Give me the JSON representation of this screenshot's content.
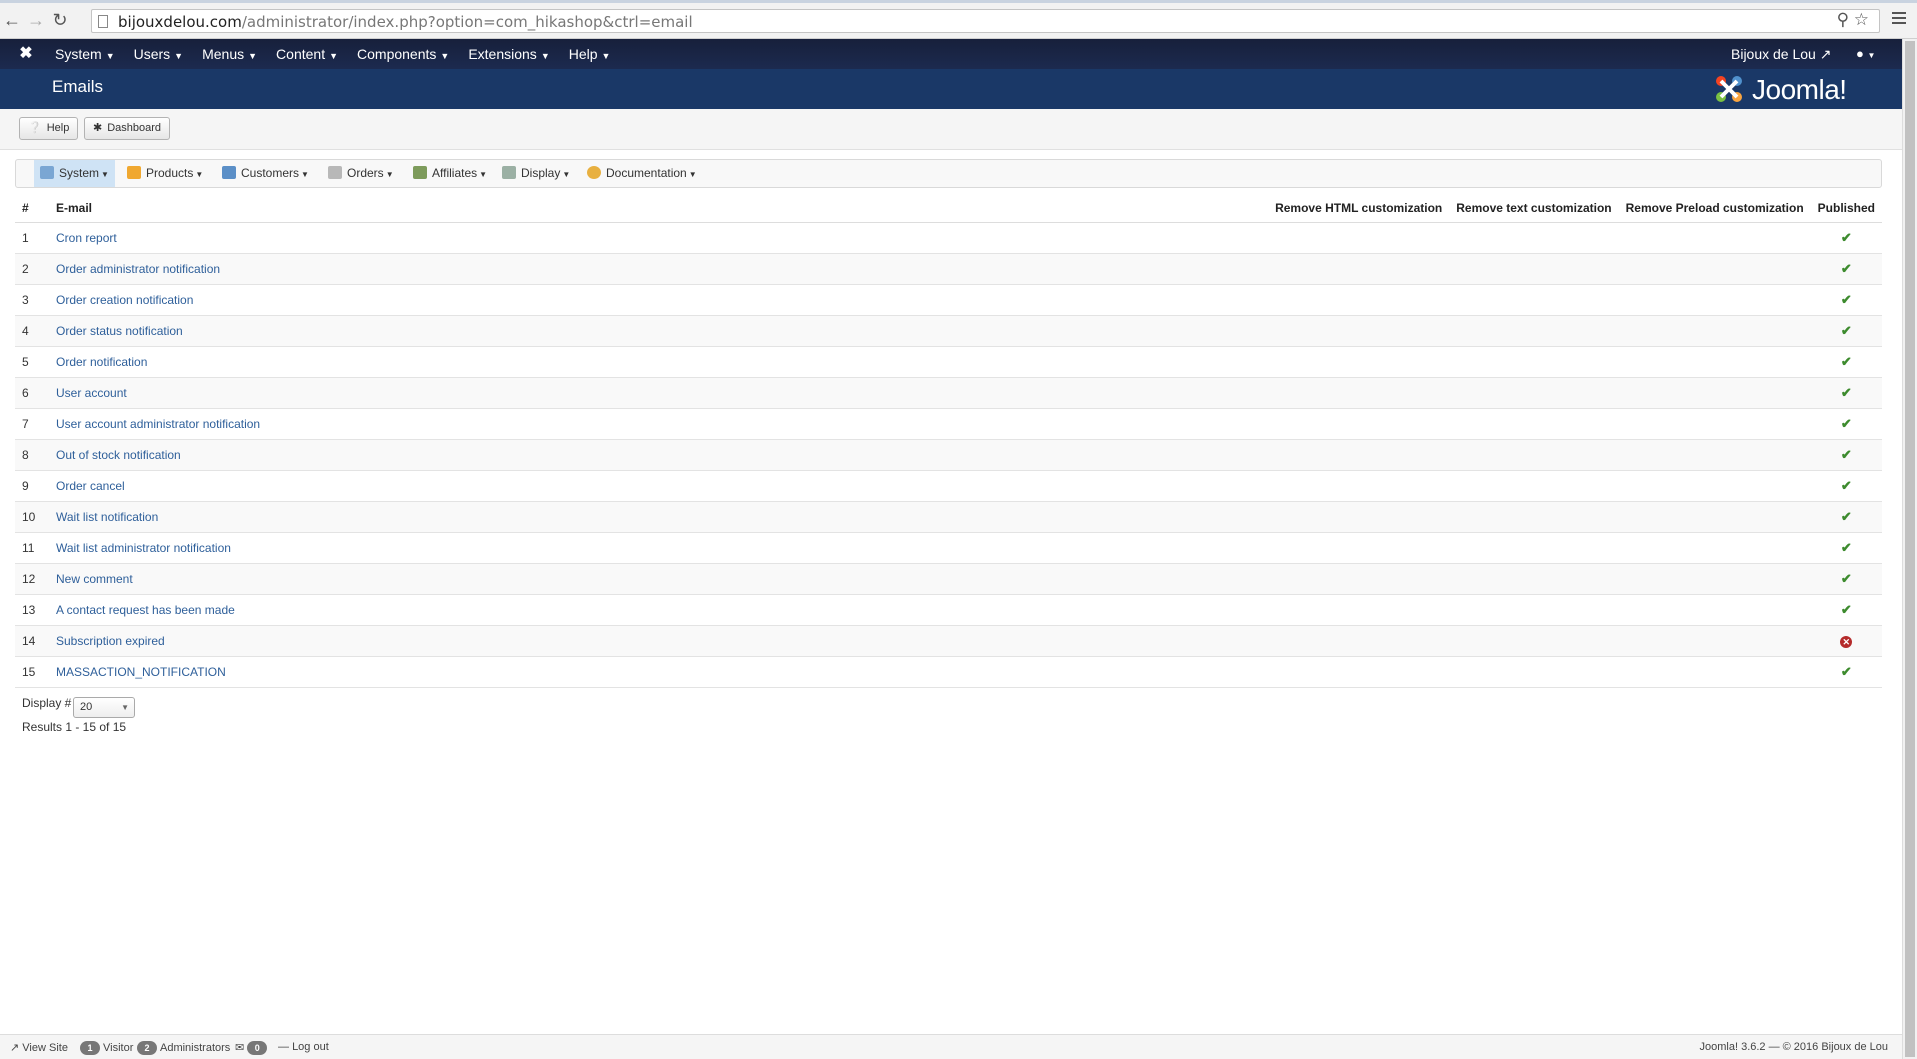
{
  "browser": {
    "url_domain": "bijouxdelou.com",
    "url_path": "/administrator/index.php?option=com_hikashop&ctrl=email"
  },
  "topnav": {
    "items": [
      "System",
      "Users",
      "Menus",
      "Content",
      "Components",
      "Extensions",
      "Help"
    ],
    "site_name": "Bijoux de Lou"
  },
  "header": {
    "title": "Emails",
    "logo_text": "Joomla!"
  },
  "toolbar": {
    "help_label": "Help",
    "dashboard_label": "Dashboard"
  },
  "hika_menu": {
    "items": [
      "System",
      "Products",
      "Customers",
      "Orders",
      "Affiliates",
      "Display",
      "Documentation"
    ]
  },
  "table": {
    "columns": [
      "#",
      "E-mail",
      "Remove HTML customization",
      "Remove text customization",
      "Remove Preload customization",
      "Published"
    ],
    "rows": [
      {
        "num": "1",
        "name": "Cron report",
        "published": true
      },
      {
        "num": "2",
        "name": "Order administrator notification",
        "published": true
      },
      {
        "num": "3",
        "name": "Order creation notification",
        "published": true
      },
      {
        "num": "4",
        "name": "Order status notification",
        "published": true
      },
      {
        "num": "5",
        "name": "Order notification",
        "published": true
      },
      {
        "num": "6",
        "name": "User account",
        "published": true
      },
      {
        "num": "7",
        "name": "User account administrator notification",
        "published": true
      },
      {
        "num": "8",
        "name": "Out of stock notification",
        "published": true
      },
      {
        "num": "9",
        "name": "Order cancel",
        "published": true
      },
      {
        "num": "10",
        "name": "Wait list notification",
        "published": true
      },
      {
        "num": "11",
        "name": "Wait list administrator notification",
        "published": true
      },
      {
        "num": "12",
        "name": "New comment",
        "published": true
      },
      {
        "num": "13",
        "name": "A contact request has been made",
        "published": true
      },
      {
        "num": "14",
        "name": "Subscription expired",
        "published": false
      },
      {
        "num": "15",
        "name": "MASSACTION_NOTIFICATION",
        "published": true
      }
    ]
  },
  "pagination": {
    "display_label": "Display #",
    "display_value": "20",
    "results_text": "Results 1 - 15 of 15"
  },
  "statusbar": {
    "view_site": "View Site",
    "visitors_count": "1",
    "visitors_label": "Visitor",
    "admins_count": "2",
    "admins_label": "Administrators",
    "messages_count": "0",
    "logout": "Log out",
    "footer": "Joomla! 3.6.2 — © 2016 Bijoux de Lou"
  },
  "colors": {
    "navbar": "#17203b",
    "header": "#1a3867",
    "link": "#2e5f9a",
    "published_ok": "#3d8b2e",
    "unpublished": "#b52b2b"
  }
}
